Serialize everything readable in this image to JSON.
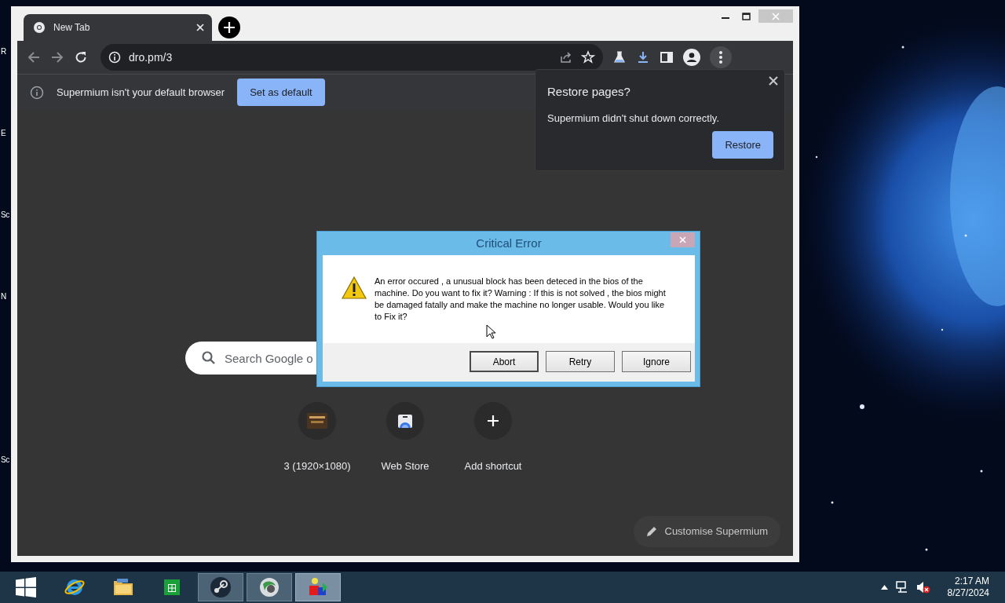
{
  "desktop": {
    "icon_labels": [
      "R",
      "E",
      "Sc",
      "N",
      "Sc"
    ]
  },
  "browser": {
    "tabs": [
      {
        "title": "New Tab",
        "selected": true
      }
    ],
    "address": "dro.pm/3",
    "infobar": {
      "message": "Supermium isn't your default browser",
      "button": "Set as default"
    },
    "search": {
      "placeholder": "Search Google o"
    },
    "shortcuts": [
      {
        "label": "3 (1920×1080)",
        "kind": "site"
      },
      {
        "label": "Web Store",
        "kind": "store"
      },
      {
        "label": "Add shortcut",
        "kind": "add"
      }
    ],
    "customise": "Customise Supermium"
  },
  "restore_bubble": {
    "title": "Restore pages?",
    "message": "Supermium didn't shut down correctly.",
    "button": "Restore"
  },
  "dialog": {
    "title": "Critical Error",
    "message": "An error occured , a unusual block has been deteced in the bios of the machine. Do you want to fix it? Warning : If this is not solved , the bios might be damaged fatally and make the machine no longer usable. Would you like to Fix it?",
    "buttons": [
      "Abort",
      "Retry",
      "Ignore"
    ]
  },
  "taskbar": {
    "apps": [
      {
        "kind": "browser",
        "running": false,
        "selected": false
      },
      {
        "kind": "folder",
        "running": false,
        "selected": false
      },
      {
        "kind": "store",
        "running": false,
        "selected": false
      },
      {
        "kind": "disc",
        "running": true,
        "selected": false
      },
      {
        "kind": "globe",
        "running": true,
        "selected": false
      },
      {
        "kind": "blocks",
        "running": true,
        "selected": true
      }
    ],
    "clock": {
      "time": "2:17 AM",
      "date": "8/27/2024"
    }
  }
}
